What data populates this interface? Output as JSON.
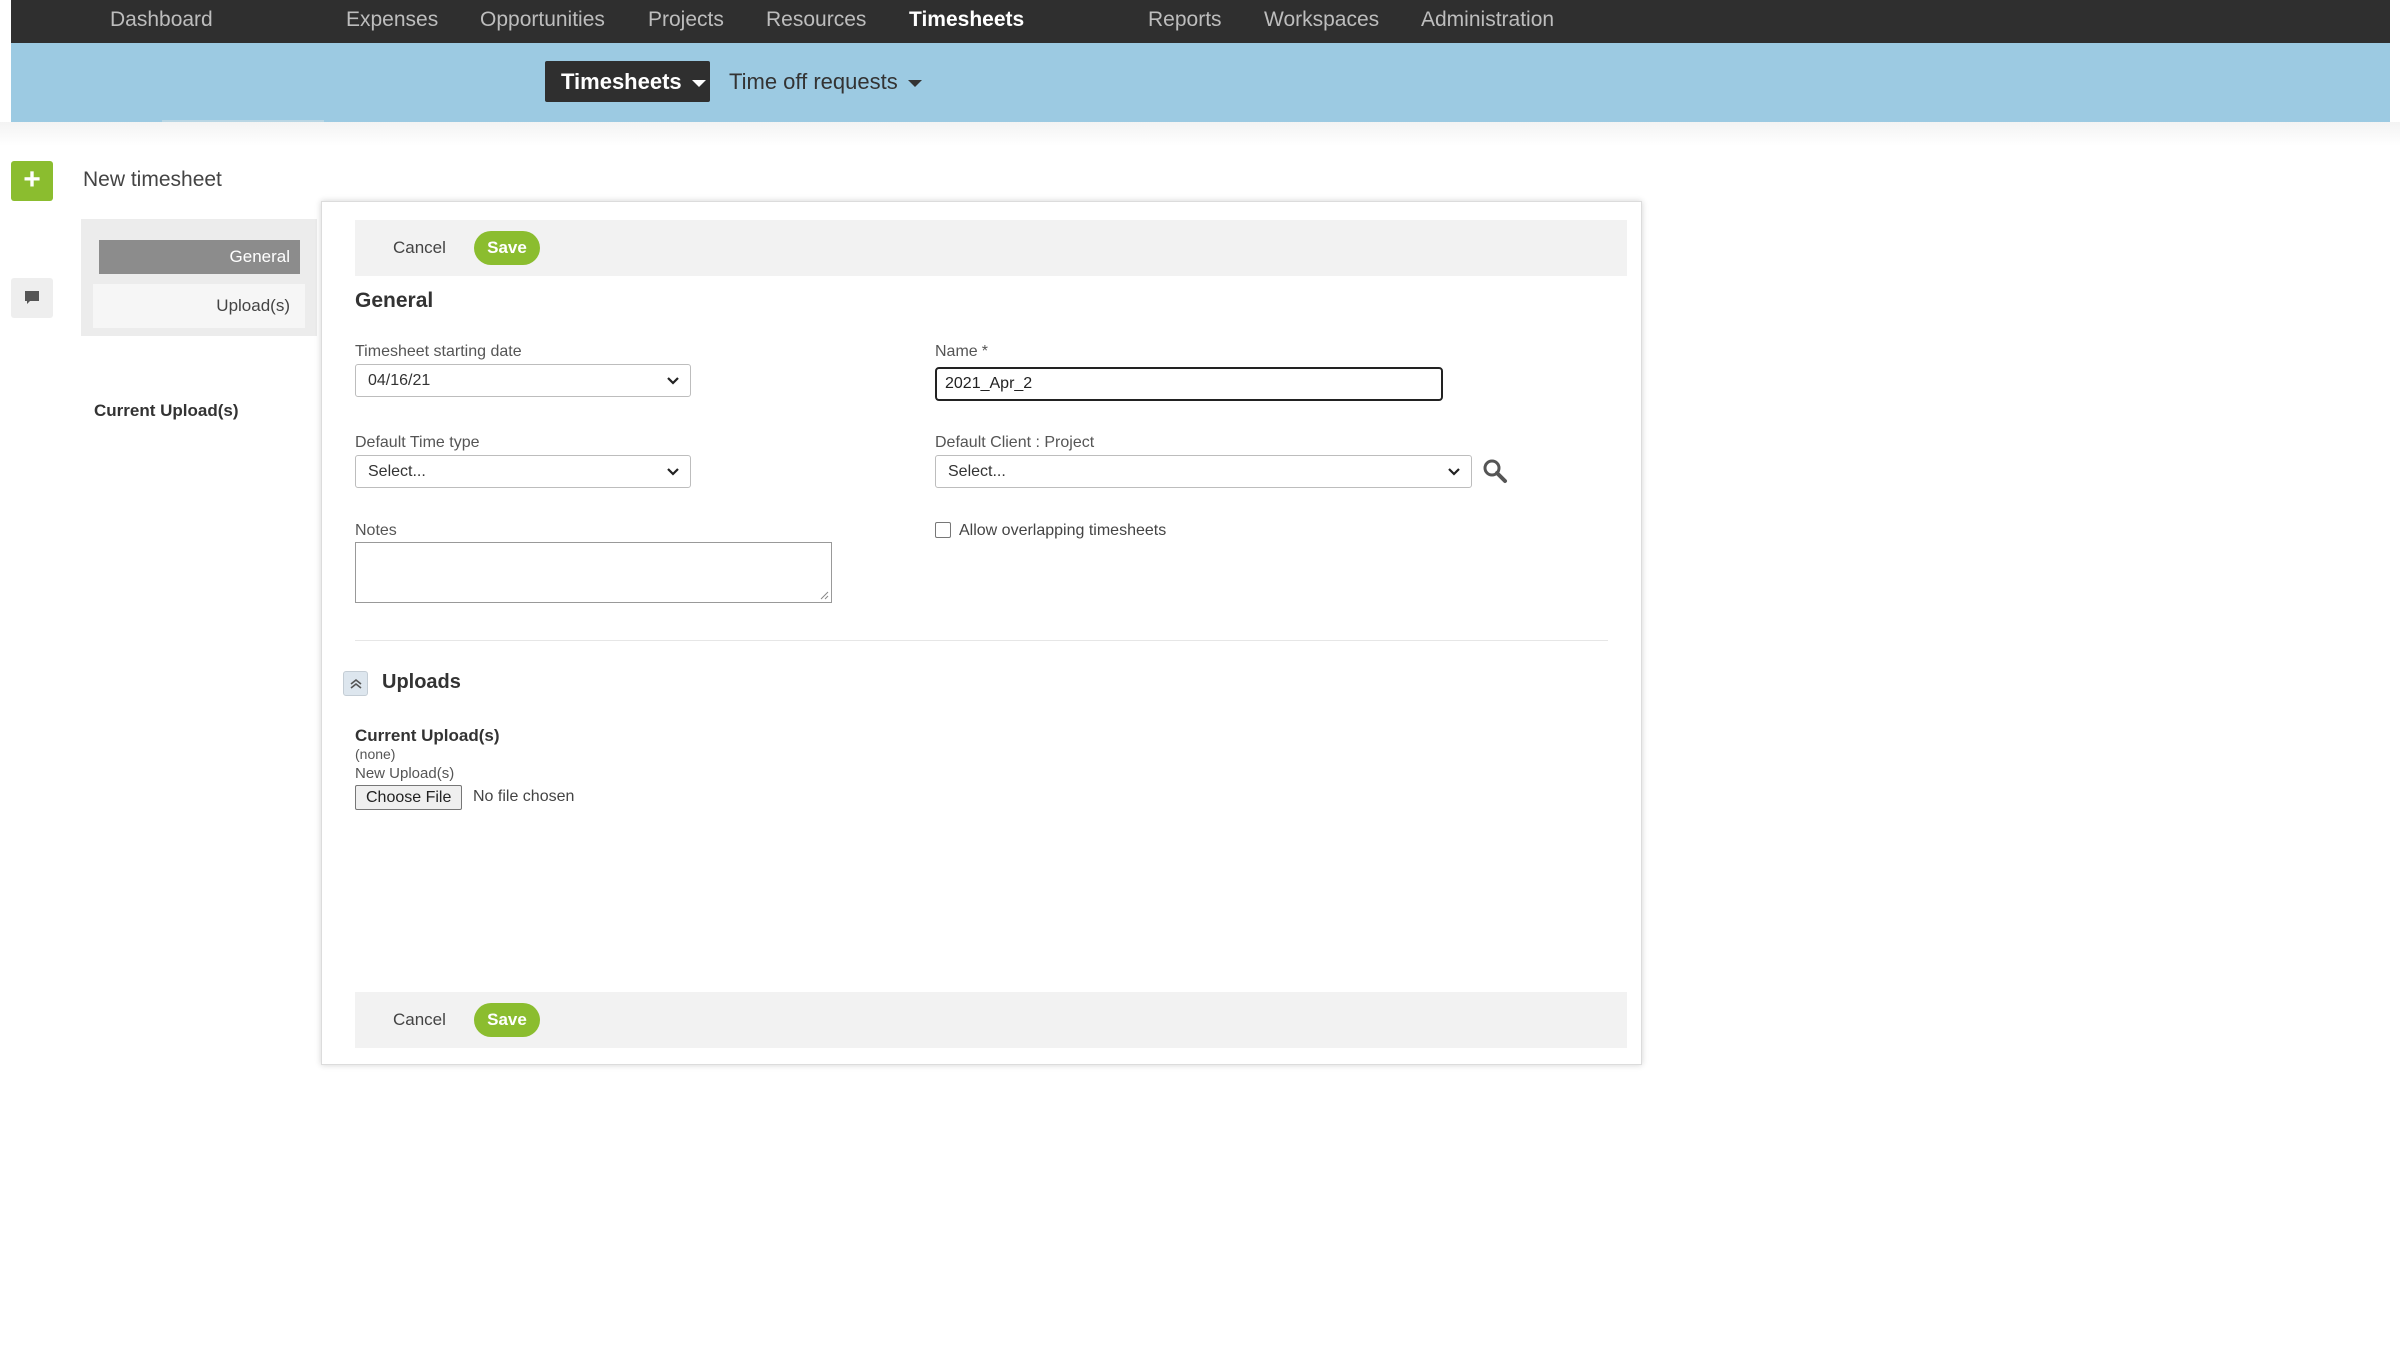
{
  "topnav": {
    "items": [
      {
        "label": "Dashboard",
        "active": false
      },
      {
        "label": "Expenses",
        "active": false
      },
      {
        "label": "Opportunities",
        "active": false
      },
      {
        "label": "Projects",
        "active": false
      },
      {
        "label": "Resources",
        "active": false
      },
      {
        "label": "Timesheets",
        "active": true
      },
      {
        "label": "Reports",
        "active": false
      },
      {
        "label": "Workspaces",
        "active": false
      },
      {
        "label": "Administration",
        "active": false
      }
    ]
  },
  "subnav": {
    "active_tab": "Timesheets",
    "other_tab": "Time off requests"
  },
  "page": {
    "title": "New timesheet"
  },
  "sidebar": {
    "tabs": [
      {
        "label": "General",
        "active": true
      },
      {
        "label": "Upload(s)",
        "active": false
      }
    ],
    "current_uploads_label": "Current Upload(s)"
  },
  "actions": {
    "cancel_label": "Cancel",
    "save_label": "Save"
  },
  "general": {
    "section_title": "General",
    "start_date_label": "Timesheet starting date",
    "start_date_value": "04/16/21",
    "name_label": "Name",
    "name_required_mark": "*",
    "name_value": "2021_Apr_2",
    "time_type_label": "Default Time type",
    "time_type_value": "Select...",
    "client_project_label": "Default Client : Project",
    "client_project_value": "Select...",
    "notes_label": "Notes",
    "notes_value": "",
    "allow_overlap_label": "Allow overlapping timesheets",
    "allow_overlap_checked": false
  },
  "uploads": {
    "section_title": "Uploads",
    "current_label": "Current Upload(s)",
    "current_value": "(none)",
    "new_label": "New Upload(s)",
    "choose_file_label": "Choose File",
    "file_status": "No file chosen"
  },
  "colors": {
    "topnav_bg": "#2f2f2f",
    "subnav_bg": "#9ccae2",
    "accent_green": "#8bbd2f"
  }
}
